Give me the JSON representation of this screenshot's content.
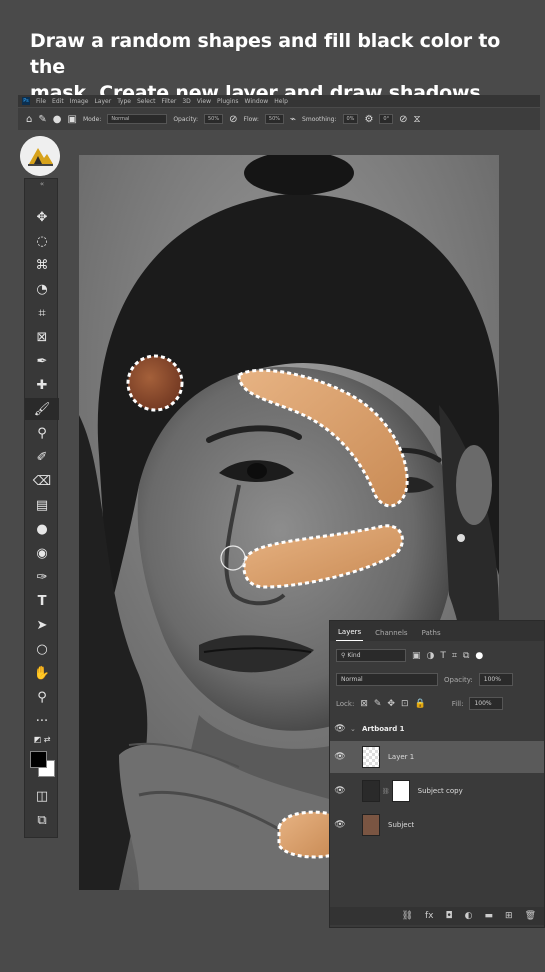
{
  "caption": {
    "line1": "Draw a random shapes and fill black color to the",
    "line2": "mask. Create new layer and draw shadows."
  },
  "menu": {
    "app_icon": "Ps",
    "items": [
      "File",
      "Edit",
      "Image",
      "Layer",
      "Type",
      "Select",
      "Filter",
      "3D",
      "View",
      "Plugins",
      "Window",
      "Help"
    ]
  },
  "options": {
    "mode_label": "Mode:",
    "mode_value": "Normal",
    "opacity_label": "Opacity:",
    "opacity_value": "50%",
    "flow_label": "Flow:",
    "flow_value": "50%",
    "smoothing_label": "Smoothing:",
    "smoothing_value": "0%",
    "angle_value": "0°"
  },
  "tools": [
    "move-tool",
    "marquee-tool",
    "lasso-tool",
    "quick-select-tool",
    "crop-tool",
    "frame-tool",
    "eyedropper-tool",
    "healing-tool",
    "brush-tool",
    "stamp-tool",
    "history-brush-tool",
    "eraser-tool",
    "gradient-tool",
    "blur-tool",
    "dodge-tool",
    "pen-tool",
    "type-tool",
    "path-select-tool",
    "shape-tool",
    "hand-tool",
    "zoom-tool",
    "more-tools"
  ],
  "layers_panel": {
    "tabs": [
      "Layers",
      "Channels",
      "Paths"
    ],
    "filter_value": "Kind",
    "blend_mode": "Normal",
    "opacity_label": "Opacity:",
    "opacity_value": "100%",
    "lock_label": "Lock:",
    "fill_label": "Fill:",
    "fill_value": "100%",
    "group_name": "Artboard 1",
    "layers": [
      "Layer 1",
      "Subject copy",
      "Subject"
    ]
  },
  "colors": {
    "accent_brush": "#d9a06d",
    "dark_brush": "#8b4a2c",
    "ui_bg": "#4a4a4a",
    "panel_bg": "#3a3a3a"
  }
}
